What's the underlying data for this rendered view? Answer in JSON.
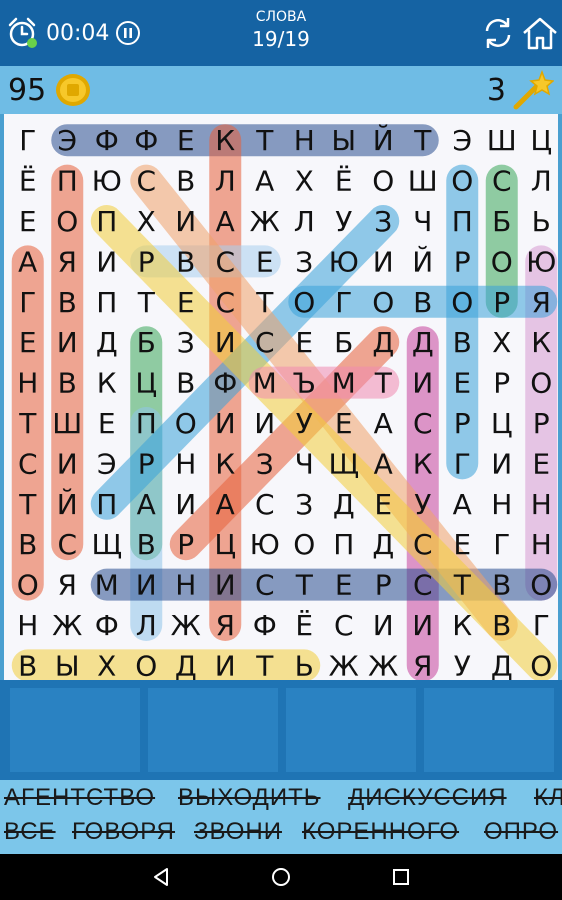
{
  "header": {
    "timer": "00:04",
    "words_label": "СЛОВА",
    "words_count": "19/19",
    "icons": {
      "alarm": "alarm-clock-icon",
      "pause": "pause-icon",
      "refresh": "refresh-icon",
      "home": "home-icon"
    }
  },
  "scorebar": {
    "coins": "95",
    "hints": "3",
    "icons": {
      "coin": "coin-icon",
      "wand": "magic-wand-icon"
    }
  },
  "grid": {
    "rows": [
      "ГЭФФЕКТНЫЙТЭШЦ",
      "ЁПЮСВЛАХЁОШОСЛ",
      "ЕОПХИАЖЛУЗЧПБЬ",
      "АЯИРВСЕЗЮИЙРОЮ",
      "ГВПТЕСТОГОВОРЯ",
      "ЕИДБЗИСЕБДДВХК",
      "НВКЦВФМЪМТИЕРО",
      "ТШЕПОИИУЕАСРЦР",
      "СИЭРНКЗЧЩАКГИЕ",
      "ТЙПАИАСЗДЕУАНН",
      "ВСЩВРЦЮОПДСЕГН",
      "ОЯМИНИСТЕРСТВО",
      "НЖФЛЖЯФЁСИИКВГ",
      "ВЫХОДИТЬЖЖЯУДО"
    ],
    "highlights": [
      {
        "from": [
          0,
          1
        ],
        "to": [
          0,
          10
        ],
        "color": "#2a4f8f"
      },
      {
        "from": [
          1,
          1
        ],
        "to": [
          10,
          1
        ],
        "color": "#e8603a"
      },
      {
        "from": [
          3,
          0
        ],
        "to": [
          11,
          0
        ],
        "color": "#e8603a"
      },
      {
        "from": [
          1,
          11
        ],
        "to": [
          8,
          11
        ],
        "color": "#3aa2d8"
      },
      {
        "from": [
          1,
          12
        ],
        "to": [
          4,
          12
        ],
        "color": "#3aa85a"
      },
      {
        "from": [
          3,
          13
        ],
        "to": [
          11,
          13
        ],
        "color": "#d79ad2"
      },
      {
        "from": [
          5,
          10
        ],
        "to": [
          13,
          10
        ],
        "color": "#c7439c"
      },
      {
        "from": [
          5,
          3
        ],
        "to": [
          10,
          3
        ],
        "color": "#3aa85a"
      },
      {
        "from": [
          0,
          5
        ],
        "to": [
          12,
          5
        ],
        "color": "#e8603a"
      },
      {
        "from": [
          7,
          3
        ],
        "to": [
          12,
          3
        ],
        "color": "#8fc4ea"
      },
      {
        "from": [
          11,
          2
        ],
        "to": [
          11,
          13
        ],
        "color": "#2a4f8f"
      },
      {
        "from": [
          13,
          0
        ],
        "to": [
          13,
          7
        ],
        "color": "#f2cd3a"
      },
      {
        "from": [
          4,
          7
        ],
        "to": [
          4,
          13
        ],
        "color": "#3aa2d8"
      },
      {
        "from": [
          3,
          3
        ],
        "to": [
          3,
          6
        ],
        "color": "#a9cfee"
      },
      {
        "from": [
          2,
          9
        ],
        "to": [
          9,
          2
        ],
        "color": "#3aa2d8"
      },
      {
        "from": [
          5,
          9
        ],
        "to": [
          10,
          4
        ],
        "color": "#e8603a"
      },
      {
        "from": [
          1,
          3
        ],
        "to": [
          12,
          12
        ],
        "color": "#f0a26a"
      },
      {
        "from": [
          2,
          2
        ],
        "to": [
          13,
          13
        ],
        "color": "#f2cd3a"
      },
      {
        "from": [
          6,
          6
        ],
        "to": [
          6,
          9
        ],
        "color": "#f08ab0"
      }
    ]
  },
  "wordlist": {
    "row1": [
      "АГЕНТСТВО",
      "ВЫХОДИТЬ",
      "ДИСКУССИЯ",
      "КЛ"
    ],
    "row2": [
      "ВСЕ",
      "ГОВОРЯ",
      "ЗВОНИ",
      "КОРЕННОГО",
      "ОПРО"
    ]
  },
  "navbar": {
    "icons": {
      "back": "back-triangle-icon",
      "home": "home-circle-icon",
      "recents": "recents-square-icon"
    }
  }
}
